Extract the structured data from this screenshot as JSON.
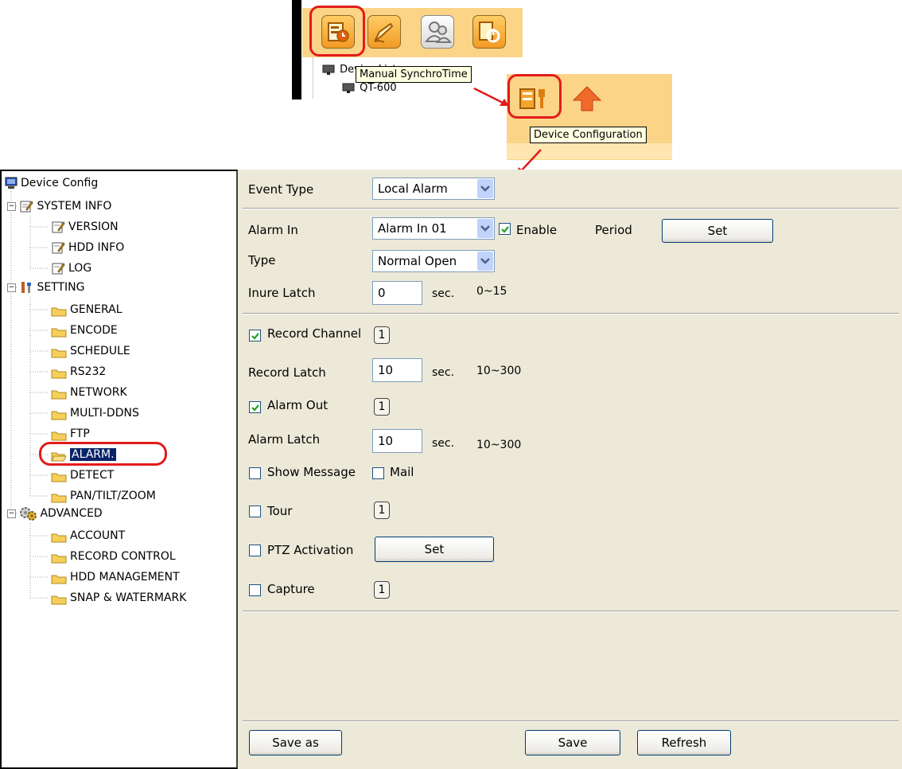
{
  "toolbar": {
    "buttons": [
      "device-info-icon",
      "pen-icon",
      "users-icon",
      "power-icon"
    ],
    "device_list_label": "Device List",
    "device_item": "QT-600"
  },
  "tooltips": {
    "manual_sync": "Manual SynchroTime",
    "device_config": "Device Configuration"
  },
  "tree": {
    "root": "Device Config",
    "system_info": "SYSTEM INFO",
    "version": "VERSION",
    "hdd_info": "HDD INFO",
    "log": "LOG",
    "setting": "SETTING",
    "general": "GENERAL",
    "encode": "ENCODE",
    "schedule": "SCHEDULE",
    "rs232": "RS232",
    "network": "NETWORK",
    "multi_ddns": "MULTI-DDNS",
    "ftp": "FTP",
    "alarm": "ALARM.",
    "detect": "DETECT",
    "ptz": "PAN/TILT/ZOOM",
    "advanced": "ADVANCED",
    "account": "ACCOUNT",
    "record_control": "RECORD CONTROL",
    "hdd_management": "HDD MANAGEMENT",
    "snap_watermark": "SNAP & WATERMARK"
  },
  "form": {
    "event_type_label": "Event Type",
    "event_type_value": "Local Alarm",
    "alarm_in_label": "Alarm In",
    "alarm_in_value": "Alarm In 01",
    "enable_label": "Enable",
    "enable_checked": true,
    "period_label": "Period",
    "set_label": "Set",
    "type_label": "Type",
    "type_value": "Normal Open",
    "inure_latch_label": "Inure Latch",
    "inure_latch_value": "0",
    "sec": "sec.",
    "inure_range": "0~15",
    "record_channel_label": "Record Channel",
    "record_channel_checked": true,
    "channel_num": "1",
    "record_latch_label": "Record Latch",
    "record_latch_value": "10",
    "record_range": "10~300",
    "alarm_out_label": "Alarm Out",
    "alarm_out_checked": true,
    "alarm_latch_label": "Alarm Latch",
    "alarm_latch_value": "10",
    "alarm_range": "10~300",
    "show_message_label": "Show Message",
    "mail_label": "Mail",
    "tour_label": "Tour",
    "ptz_label": "PTZ Activation",
    "capture_label": "Capture"
  },
  "footer": {
    "save_as": "Save as",
    "save": "Save",
    "refresh": "Refresh"
  },
  "colors": {
    "highlight_ring": "#e31b1b",
    "selection": "#0a246a",
    "toolbar_orange": "#fbd487",
    "panel_bg": "#ece9d8"
  }
}
